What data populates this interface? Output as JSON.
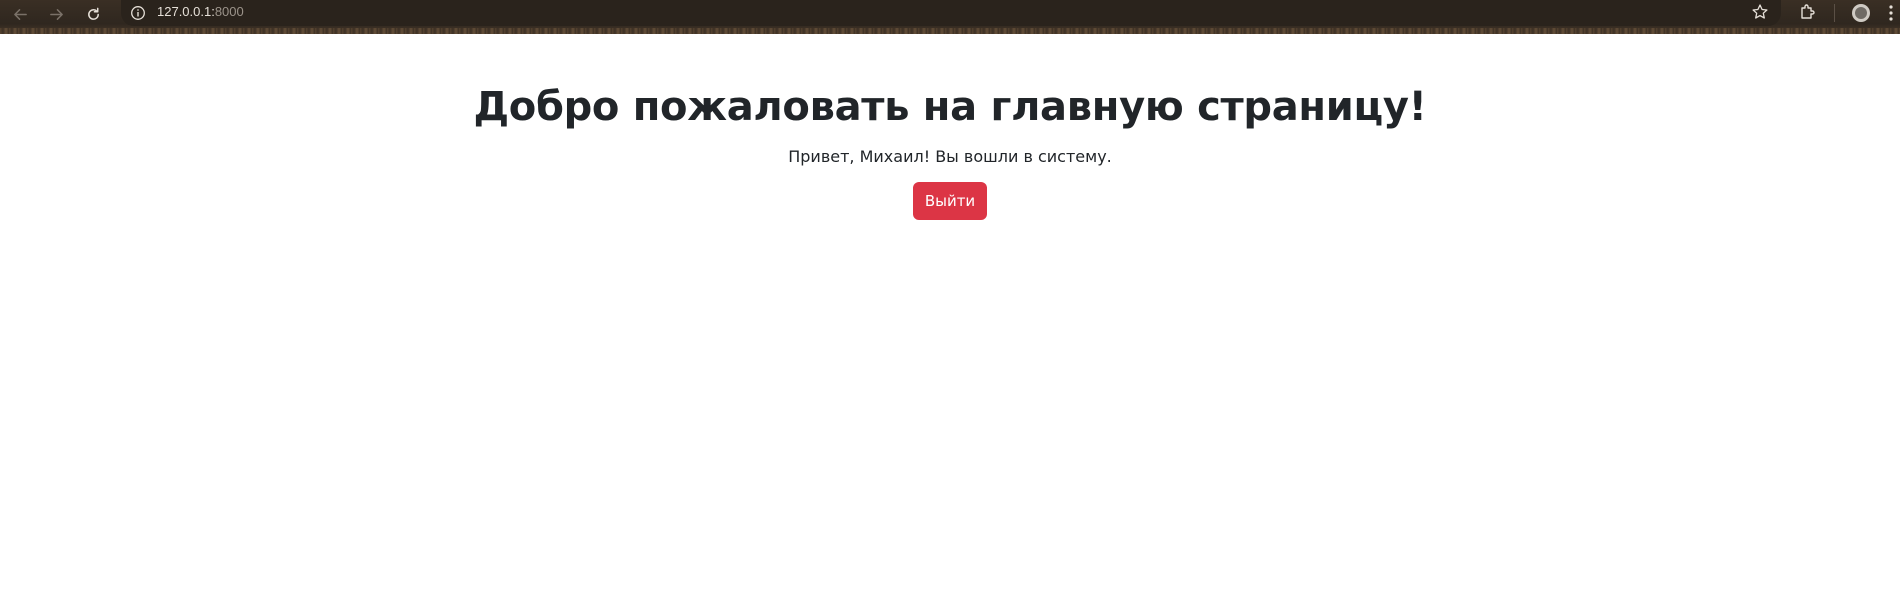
{
  "browser": {
    "url_host": "127.0.0.1:",
    "url_port": "8000",
    "icons": {
      "back": "arrow-left-icon",
      "forward": "arrow-right-icon",
      "reload": "reload-icon",
      "site_info": "info-icon",
      "bookmark": "star-icon",
      "extensions": "puzzle-icon",
      "profile": "profile-avatar",
      "menu": "kebab-menu-icon"
    }
  },
  "page": {
    "title": "Добро пожаловать на главную страницу!",
    "greeting": "Привет, Михаил! Вы вошли в систему.",
    "logout_label": "Выйти"
  },
  "colors": {
    "logout_button": "#dc3545",
    "text": "#212529",
    "background": "#ffffff",
    "chrome": "#2f271f"
  }
}
